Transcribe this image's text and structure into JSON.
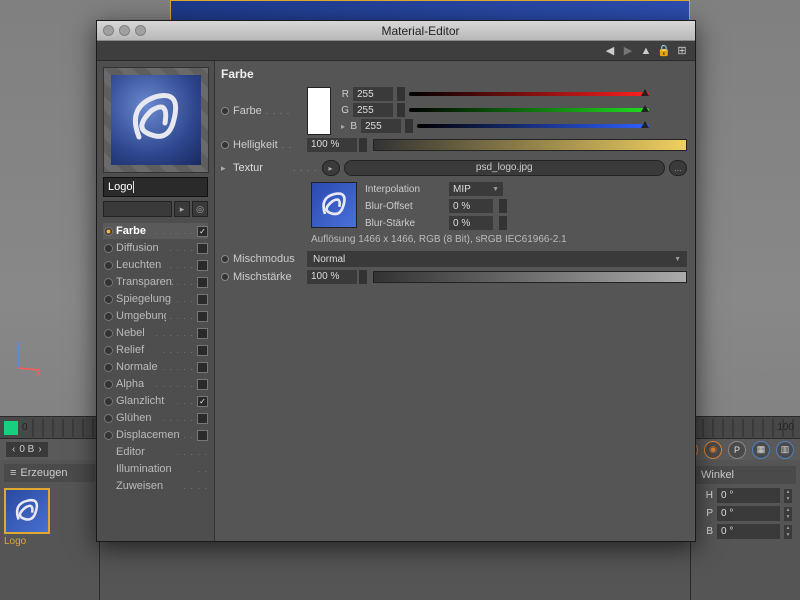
{
  "window": {
    "title": "Material-Editor",
    "material_name": "Logo"
  },
  "section_title": "Farbe",
  "color": {
    "label": "Farbe",
    "r_label": "R",
    "r": "255",
    "g_label": "G",
    "g": "255",
    "b_label": "B",
    "b": "255"
  },
  "brightness": {
    "label": "Helligkeit",
    "value": "100 %"
  },
  "texture": {
    "label": "Textur",
    "file": "psd_logo.jpg",
    "interpolation_label": "Interpolation",
    "interpolation": "MIP",
    "blur_offset_label": "Blur-Offset",
    "blur_offset": "0 %",
    "blur_strength_label": "Blur-Stärke",
    "blur_strength": "0 %",
    "resolution": "Auflösung 1466 x 1466, RGB (8 Bit), sRGB IEC61966-2.1"
  },
  "mix": {
    "mode_label": "Mischmodus",
    "mode": "Normal",
    "strength_label": "Mischstärke",
    "strength": "100 %"
  },
  "channels": [
    {
      "label": "Farbe",
      "checked": true,
      "selected": true,
      "hasBox": true
    },
    {
      "label": "Diffusion",
      "checked": false,
      "selected": false,
      "hasBox": true
    },
    {
      "label": "Leuchten",
      "checked": false,
      "selected": false,
      "hasBox": true
    },
    {
      "label": "Transparenz",
      "checked": false,
      "selected": false,
      "hasBox": true
    },
    {
      "label": "Spiegelung",
      "checked": false,
      "selected": false,
      "hasBox": true
    },
    {
      "label": "Umgebung",
      "checked": false,
      "selected": false,
      "hasBox": true
    },
    {
      "label": "Nebel",
      "checked": false,
      "selected": false,
      "hasBox": true
    },
    {
      "label": "Relief",
      "checked": false,
      "selected": false,
      "hasBox": true
    },
    {
      "label": "Normale",
      "checked": false,
      "selected": false,
      "hasBox": true
    },
    {
      "label": "Alpha",
      "checked": false,
      "selected": false,
      "hasBox": true
    },
    {
      "label": "Glanzlicht",
      "checked": true,
      "selected": false,
      "hasBox": true
    },
    {
      "label": "Glühen",
      "checked": false,
      "selected": false,
      "hasBox": true
    },
    {
      "label": "Displacement",
      "checked": false,
      "selected": false,
      "hasBox": true
    },
    {
      "label": "Editor",
      "checked": false,
      "selected": false,
      "hasBox": false,
      "nobullet": true
    },
    {
      "label": "Illumination",
      "checked": false,
      "selected": false,
      "hasBox": false,
      "nobullet": true
    },
    {
      "label": "Zuweisen",
      "checked": false,
      "selected": false,
      "hasBox": false,
      "nobullet": true
    }
  ],
  "timeline": {
    "start": "0",
    "end": "100",
    "field": "0 B",
    "field2": "0 B"
  },
  "materials_tab": "Erzeugen",
  "material_thumb_label": "Logo",
  "rotation": {
    "title": "Winkel",
    "h_label": "H",
    "h": "0 °",
    "p_label": "P",
    "p": "0 °",
    "b_label": "B",
    "b": "0 °"
  },
  "axis": {
    "x": "x",
    "z": "z"
  }
}
